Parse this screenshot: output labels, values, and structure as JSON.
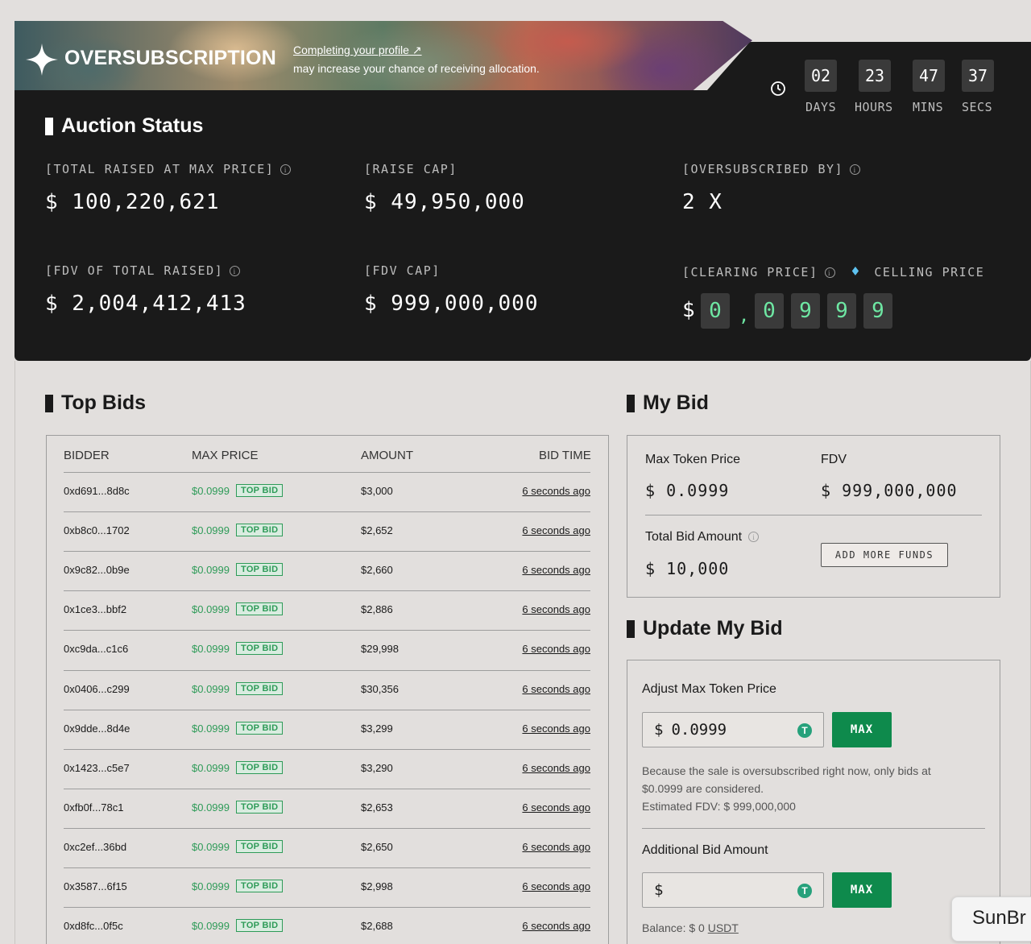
{
  "banner": {
    "brand": "OVERSUBSCRIPTION",
    "promo_link": "Completing your profile ↗",
    "promo_text": "may increase your chance of receiving allocation."
  },
  "countdown": [
    {
      "value": "02",
      "label": "DAYS"
    },
    {
      "value": "23",
      "label": "HOURS"
    },
    {
      "value": "47",
      "label": "MINS"
    },
    {
      "value": "37",
      "label": "SECS"
    }
  ],
  "auction": {
    "title": "Auction Status",
    "total_raised_label": "[TOTAL RAISED AT MAX PRICE]",
    "total_raised_value": "$ 100,220,621",
    "raise_cap_label": "[RAISE CAP]",
    "raise_cap_value": "$ 49,950,000",
    "oversubscribed_label": "[OVERSUBSCRIBED BY]",
    "oversubscribed_value": "2 X",
    "fdv_total_label": "[FDV OF TOTAL RAISED]",
    "fdv_total_value": "$ 2,004,412,413",
    "fdv_cap_label": "[FDV CAP]",
    "fdv_cap_value": "$ 999,000,000",
    "clearing_label": "[CLEARING PRICE]",
    "ceiling_label": "CELLING PRICE",
    "clearing_dollar": "$",
    "clearing_digits": [
      "0",
      "0",
      "9",
      "9",
      "9"
    ],
    "clearing_separator": ","
  },
  "top_bids": {
    "title": "Top Bids",
    "columns": [
      "BIDDER",
      "MAX PRICE",
      "AMOUNT",
      "BID TIME"
    ],
    "badge": "TOP BID",
    "rows": [
      {
        "bidder": "0xd691...8d8c",
        "price": "$0.0999",
        "amount": "$3,000",
        "time": "6 seconds ago"
      },
      {
        "bidder": "0xb8c0...1702",
        "price": "$0.0999",
        "amount": "$2,652",
        "time": "6 seconds ago"
      },
      {
        "bidder": "0x9c82...0b9e",
        "price": "$0.0999",
        "amount": "$2,660",
        "time": "6 seconds ago"
      },
      {
        "bidder": "0x1ce3...bbf2",
        "price": "$0.0999",
        "amount": "$2,886",
        "time": "6 seconds ago"
      },
      {
        "bidder": "0xc9da...c1c6",
        "price": "$0.0999",
        "amount": "$29,998",
        "time": "6 seconds ago"
      },
      {
        "bidder": "0x0406...c299",
        "price": "$0.0999",
        "amount": "$30,356",
        "time": "6 seconds ago"
      },
      {
        "bidder": "0x9dde...8d4e",
        "price": "$0.0999",
        "amount": "$3,299",
        "time": "6 seconds ago"
      },
      {
        "bidder": "0x1423...c5e7",
        "price": "$0.0999",
        "amount": "$3,290",
        "time": "6 seconds ago"
      },
      {
        "bidder": "0xfb0f...78c1",
        "price": "$0.0999",
        "amount": "$2,653",
        "time": "6 seconds ago"
      },
      {
        "bidder": "0xc2ef...36bd",
        "price": "$0.0999",
        "amount": "$2,650",
        "time": "6 seconds ago"
      },
      {
        "bidder": "0x3587...6f15",
        "price": "$0.0999",
        "amount": "$2,998",
        "time": "6 seconds ago"
      },
      {
        "bidder": "0xd8fc...0f5c",
        "price": "$0.0999",
        "amount": "$2,688",
        "time": "6 seconds ago"
      }
    ]
  },
  "my_bid": {
    "title": "My Bid",
    "max_price_label": "Max Token Price",
    "max_price_value": "$ 0.0999",
    "fdv_label": "FDV",
    "fdv_value": "$ 999,000,000",
    "total_label": "Total Bid Amount",
    "total_value": "$ 10,000",
    "add_funds": "ADD MORE FUNDS"
  },
  "update_bid": {
    "title": "Update My Bid",
    "adjust_label": "Adjust Max Token Price",
    "price_currency": "$",
    "price_value": "0.0999",
    "max_label": "MAX",
    "note_line1": "Because the sale is oversubscribed right now, only bids at",
    "note_line2": "$0.0999 are considered.",
    "note_line3": "Estimated FDV: $ 999,000,000",
    "additional_label": "Additional Bid Amount",
    "amount_currency": "$",
    "amount_value": "",
    "balance_prefix": "Balance: $ 0 ",
    "balance_token": "USDT"
  },
  "chat_chip": "SunBr"
}
